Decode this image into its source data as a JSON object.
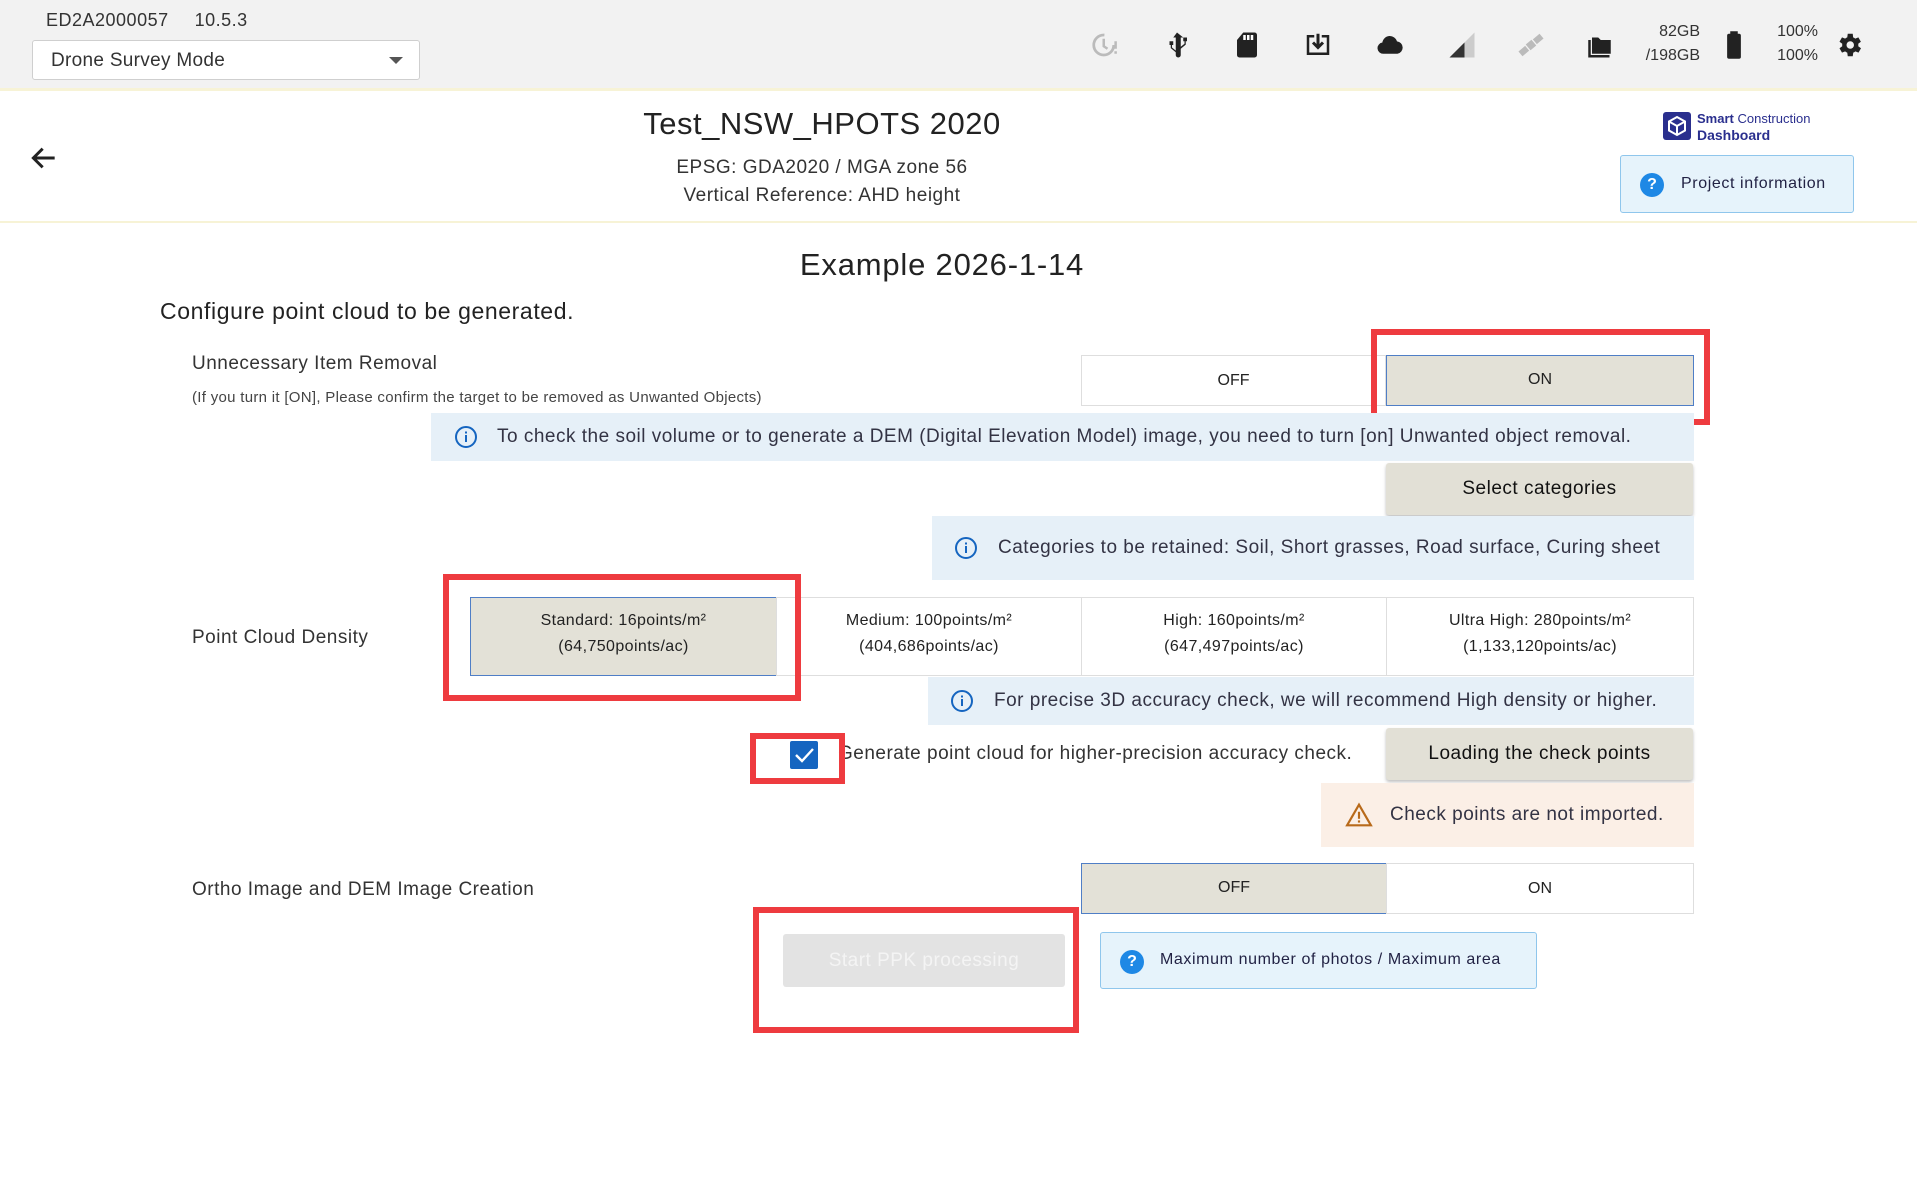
{
  "device": {
    "serial": "ED2A2000057",
    "version": "10.5.3"
  },
  "mode_select": {
    "value": "Drone Survey Mode"
  },
  "status_bar": {
    "storage_used": "82GB",
    "storage_total": "/198GB",
    "battery_1": "100%",
    "battery_2": "100%",
    "icons": [
      "sync-alert-icon",
      "usb-icon",
      "sd-card-icon",
      "download-icon",
      "cloud-icon",
      "signal-icon",
      "satellite-icon",
      "folder-icon",
      "battery-icon",
      "gear-icon"
    ]
  },
  "project": {
    "title": "Test_NSW_HPOTS 2020",
    "epsg": "EPSG: GDA2020 / MGA zone 56",
    "vertical_ref": "Vertical Reference: AHD height",
    "logo_line1_bold": "Smart",
    "logo_line1_rest": " Construction",
    "logo_line2": "Dashboard",
    "info_button": "Project information"
  },
  "main": {
    "title": "Example 2026-1-14",
    "description": "Configure point cloud to be generated."
  },
  "item_removal": {
    "label": "Unnecessary Item Removal",
    "sublabel": "(If you turn it [ON], Please confirm the target to be removed as Unwanted Objects)",
    "off_label": "OFF",
    "on_label": "ON",
    "selected": "ON",
    "info_text": "To check the soil volume or to generate a DEM (Digital Elevation Model) image, you need to turn [on] Unwanted object removal.",
    "select_categories": "Select categories",
    "categories_info": "Categories to be retained: Soil, Short grasses, Road surface, Curing sheet"
  },
  "density": {
    "label": "Point Cloud Density",
    "options": [
      {
        "line1": "Standard: 16points/m²",
        "line2": "(64,750points/ac)"
      },
      {
        "line1": "Medium: 100points/m²",
        "line2": "(404,686points/ac)"
      },
      {
        "line1": "High: 160points/m²",
        "line2": "(647,497points/ac)"
      },
      {
        "line1": "Ultra High: 280points/m²",
        "line2": "(1,133,120points/ac)"
      }
    ],
    "selected_index": 0,
    "info_text": "For precise 3D accuracy check, we will recommend High density or higher."
  },
  "accuracy_check": {
    "checked": true,
    "label": "Generate point cloud for higher-precision accuracy check.",
    "load_button": "Loading the check points",
    "warning": "Check points are not imported."
  },
  "ortho": {
    "label": "Ortho Image and DEM Image Creation",
    "off_label": "OFF",
    "on_label": "ON",
    "selected": "OFF"
  },
  "ppk_button": "Start PPK processing",
  "max_info_button": "Maximum number of photos / Maximum area",
  "colors": {
    "highlight_red": "#ee3b3f",
    "selected_bg": "#e3e1d7",
    "info_bg": "#e6f0f8",
    "warning_bg": "#fbefe6",
    "accent_blue": "#1565c0"
  }
}
